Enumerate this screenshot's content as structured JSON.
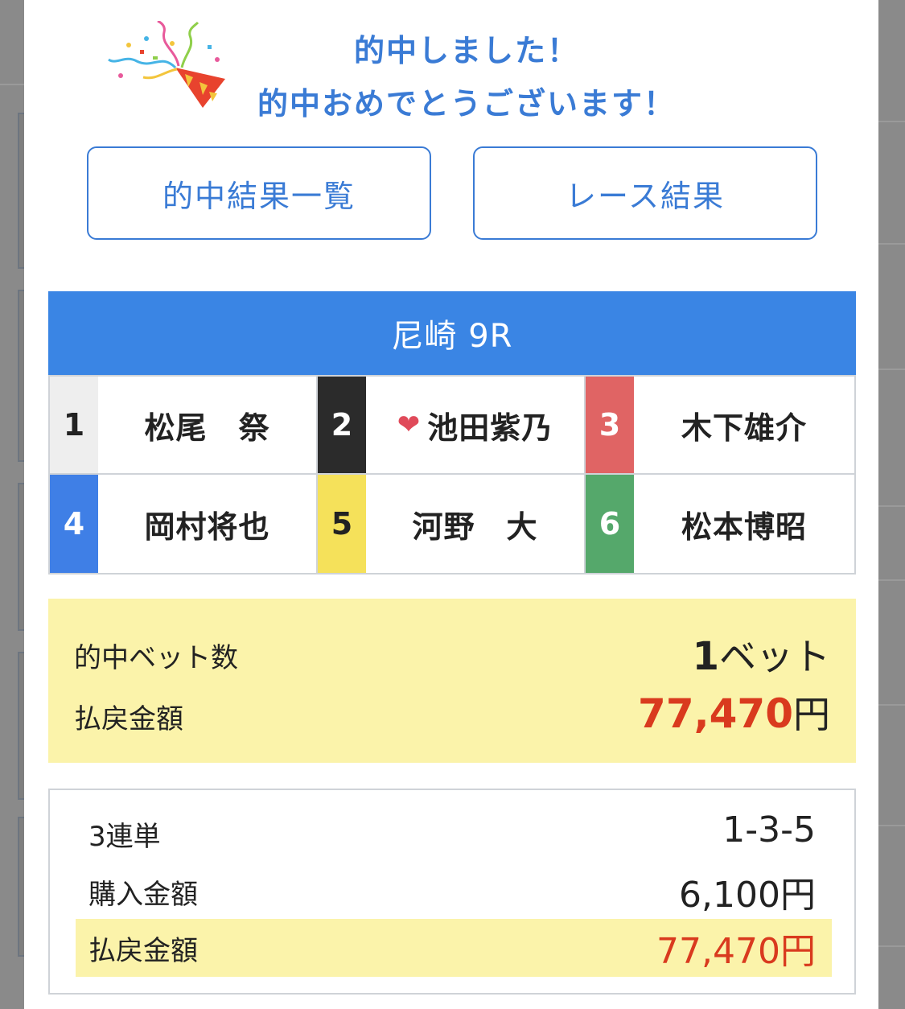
{
  "header": {
    "line1": "的中しました！",
    "line2": "的中おめでとうございます！"
  },
  "buttons": {
    "hit_list": "的中結果一覧",
    "race_result": "レース結果"
  },
  "race": {
    "title": "尼崎 9R",
    "racers": [
      {
        "num": "1",
        "name": "松尾　祭",
        "num_bg": "#eeeeee",
        "num_color": "#222222",
        "favorite": false
      },
      {
        "num": "2",
        "name": "池田紫乃",
        "num_bg": "#2b2b2b",
        "num_color": "#ffffff",
        "favorite": true
      },
      {
        "num": "3",
        "name": "木下雄介",
        "num_bg": "#e06464",
        "num_color": "#ffffff",
        "favorite": false
      },
      {
        "num": "4",
        "name": "岡村将也",
        "num_bg": "#3f7fe6",
        "num_color": "#ffffff",
        "favorite": false
      },
      {
        "num": "5",
        "name": "河野　大",
        "num_bg": "#f5e15a",
        "num_color": "#222222",
        "favorite": false
      },
      {
        "num": "6",
        "name": "松本博昭",
        "num_bg": "#55a86b",
        "num_color": "#ffffff",
        "favorite": false
      }
    ]
  },
  "summary": {
    "bets_label": "的中ベット数",
    "bets_count": "1",
    "bets_unit": "ベット",
    "payout_label": "払戻金額",
    "payout_value": "77,470",
    "payout_unit": "円"
  },
  "detail": {
    "type_label": "3連単",
    "combination": "1-3-5",
    "purchase_label": "購入金額",
    "purchase_value": "6,100円",
    "payout_label": "払戻金額",
    "payout_value": "77,470円"
  },
  "colors": {
    "accent": "#3a7bd5",
    "race_bar": "#3a85e4",
    "highlight": "#fbf3aa",
    "payout_red": "#d93a1e"
  }
}
